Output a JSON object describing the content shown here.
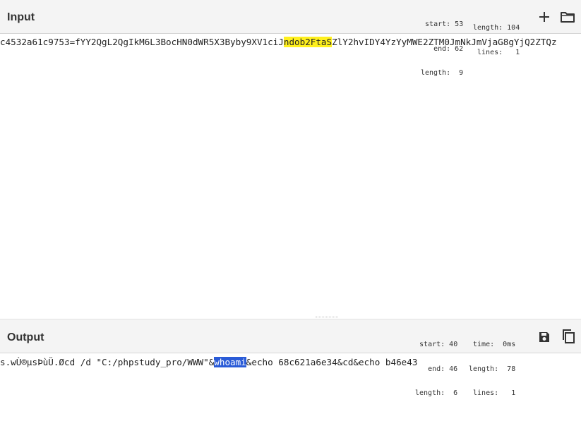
{
  "input": {
    "title": "Input",
    "stats": {
      "start": "start: 53",
      "end": "end: 62",
      "length": "length:  9",
      "total_length": "length: 104",
      "lines": "lines:   1"
    },
    "text_before": "c4532a61c9753=fYY2QgL2QgIkM6L3BocHN0dWR5X3Byby9XV1ciJ",
    "text_highlight": "ndob2FtaS",
    "text_after": "ZlY2hvIDY4YzYyMWE2ZTM0JmNkJmVjaG8gYjQ2ZTQz",
    "icons": [
      "plus-icon",
      "folder-icon"
    ]
  },
  "output": {
    "title": "Output",
    "stats": {
      "start": "start: 40",
      "end": "end: 46",
      "length": "length:  6",
      "time": "time:  0ms",
      "total_length": "length:  78",
      "lines": "lines:   1"
    },
    "text_before": "s.wÙ®µsÞùÜ.Øcd /d \"C:/phpstudy_pro/WWW\"&",
    "text_highlight": "whoami",
    "text_after": "&echo 68c621a6e34&cd&echo b46e43",
    "icons": [
      "save-icon",
      "copy-icon"
    ]
  },
  "colors": {
    "input_highlight": "#fff01e",
    "output_highlight": "#2a5bd7"
  }
}
